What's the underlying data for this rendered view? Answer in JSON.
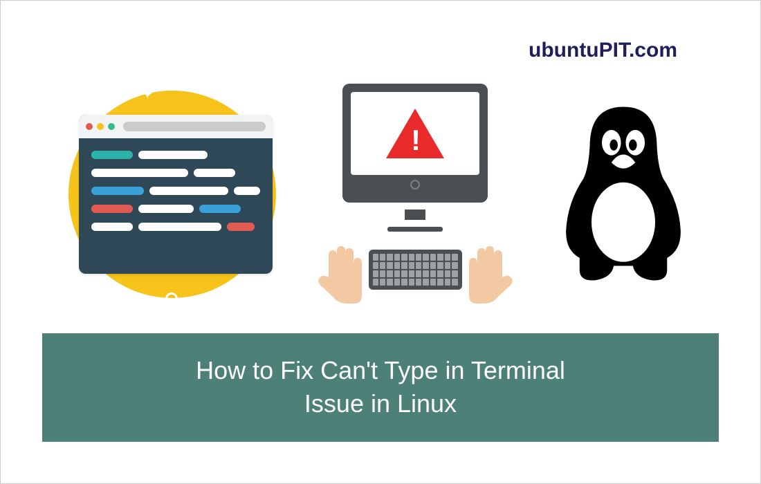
{
  "brand": "ubuntuPIT.com",
  "title_line1": "How to Fix Can't Type in Terminal",
  "title_line2": "Issue in Linux",
  "colors": {
    "banner_bg": "#4d8077",
    "brand_text": "#1e1e5a",
    "accent_yellow": "#f5c319",
    "terminal_bg": "#2f4858",
    "warning_red": "#e92a2a"
  },
  "icons": {
    "terminal": "terminal-window",
    "warning": "warning-triangle",
    "hands": "typing-hands",
    "keyboard": "keyboard",
    "penguin": "tux-linux-penguin"
  }
}
